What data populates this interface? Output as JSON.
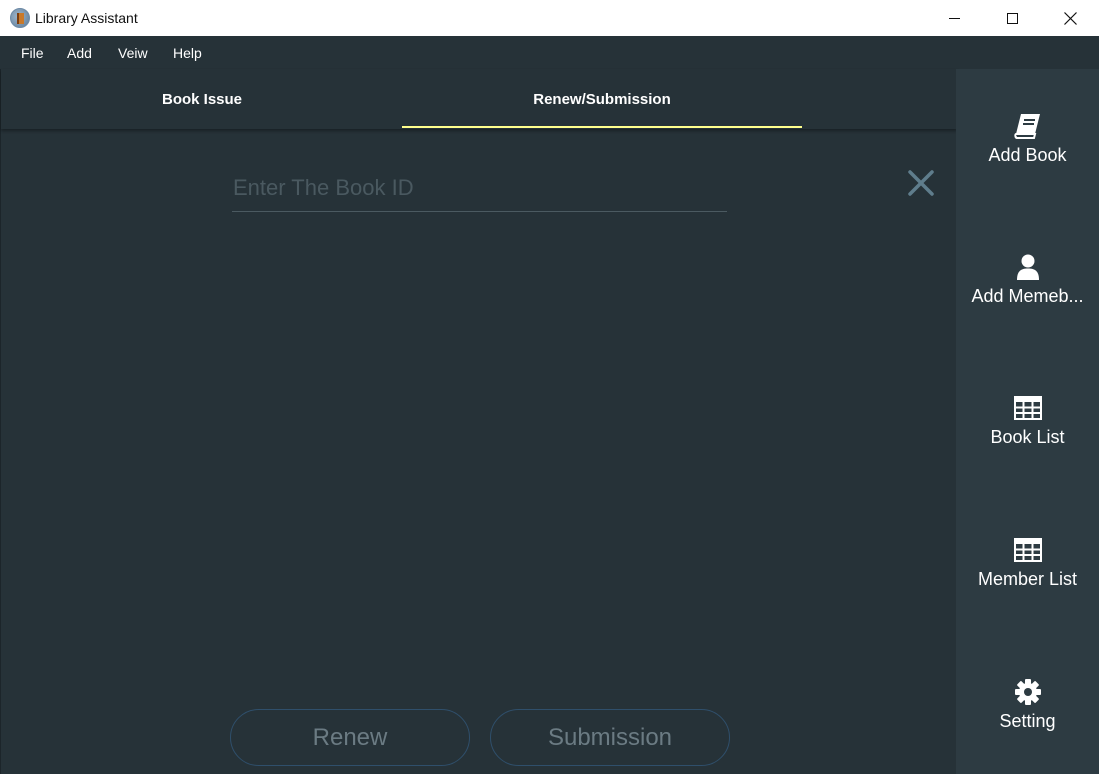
{
  "window": {
    "title": "Library Assistant"
  },
  "menu": {
    "items": [
      "File",
      "Add",
      "Veiw",
      "Help"
    ]
  },
  "tabs": [
    {
      "label": "Book Issue",
      "active": false
    },
    {
      "label": "Renew/Submission",
      "active": true
    }
  ],
  "renew_panel": {
    "book_id_placeholder": "Enter The Book ID",
    "book_id_value": "",
    "renew_label": "Renew",
    "submission_label": "Submission"
  },
  "sidebar": {
    "items": [
      {
        "label": "Add Book",
        "icon": "book-icon"
      },
      {
        "label": "Add Memeb...",
        "icon": "user-icon"
      },
      {
        "label": "Book List",
        "icon": "table-icon"
      },
      {
        "label": "Member List",
        "icon": "table-icon"
      },
      {
        "label": "Setting",
        "icon": "gear-icon"
      }
    ]
  },
  "colors": {
    "background": "#263238",
    "sidebar": "#2d3b42",
    "tab_indicator": "#ffff8d",
    "button_border": "#2f4f6b",
    "clear_icon": "#5f7d8c"
  }
}
